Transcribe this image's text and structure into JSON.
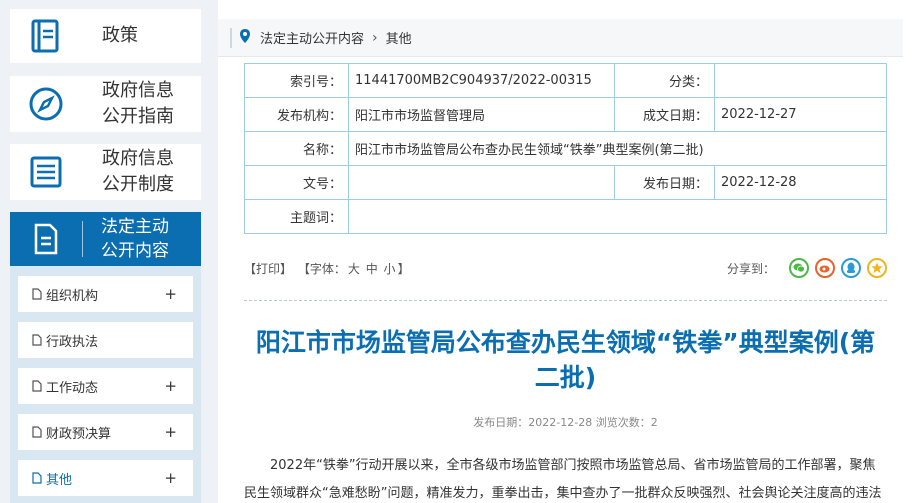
{
  "sidebar": {
    "top_items": [
      {
        "label": "政策",
        "icon": "book-icon"
      },
      {
        "label": "政府信息\n公开指南",
        "icon": "compass-icon"
      },
      {
        "label": "政府信息\n公开制度",
        "icon": "list-icon"
      }
    ],
    "active_item": {
      "label": "法定主动\n公开内容",
      "icon": "document-icon"
    },
    "sub_items": [
      {
        "label": "组织机构",
        "plus": "+"
      },
      {
        "label": "行政执法",
        "plus": ""
      },
      {
        "label": "工作动态",
        "plus": "+"
      },
      {
        "label": "财政预决算",
        "plus": "+"
      },
      {
        "label": "其他",
        "plus": "+"
      }
    ]
  },
  "breadcrumb": {
    "root": "法定主动公开内容",
    "current": "其他"
  },
  "meta": {
    "index_label": "索引号：",
    "index_value": "11441700MB2C904937/2022-00315",
    "category_label": "分类：",
    "category_value": "",
    "publisher_label": "发布机构：",
    "publisher_value": "阳江市市场监督管理局",
    "created_label": "成文日期：",
    "created_value": "2022-12-27",
    "name_label": "名称：",
    "name_value": "阳江市市场监管局公布查办民生领域“铁拳”典型案例(第二批)",
    "docno_label": "文号：",
    "docno_value": "",
    "pubdate_label": "发布日期：",
    "pubdate_value": "2022-12-28",
    "subject_label": "主题词：",
    "subject_value": ""
  },
  "tools": {
    "print": "【打印】",
    "font": "【字体：",
    "big": "大",
    "mid": "中",
    "small": "小",
    "font_end": "】",
    "share_label": "分享到："
  },
  "article": {
    "title": "阳江市市场监管局公布查办民生领域“铁拳”典型案例(第二批)",
    "pub_info": "发布日期：2022-12-28  浏览次数：2",
    "body": "2022年“铁拳”行动开展以来，全市各级市场监管部门按照市场监管总局、省市场监管局的工作部署，聚焦民生领域群众“急难愁盼”问题，精准发力，重拳出击，集中查办了一批群众反映强烈、社会舆论关注度高的违法"
  },
  "colors": {
    "accent": "#0b6eb0",
    "wechat": "#4cb848",
    "weibo": "#e8612c",
    "qq": "#2a9bd6",
    "qzone": "#f1b41d"
  }
}
